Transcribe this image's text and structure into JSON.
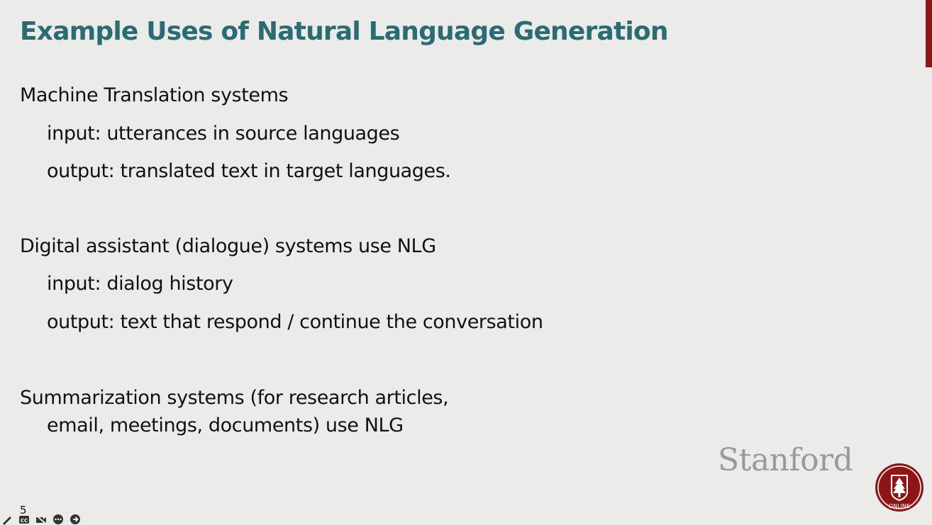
{
  "slide": {
    "title": "Example Uses of Natural Language Generation",
    "sections": [
      {
        "heading": "Machine Translation systems",
        "items": [
          "input: utterances in source languages",
          "output: translated text in target languages."
        ]
      },
      {
        "heading": "Digital assistant (dialogue) systems use NLG",
        "items": [
          "input: dialog history",
          "output: text that respond / continue the conversation"
        ]
      },
      {
        "heading": "Summarization systems (for research articles,",
        "items": [
          "email, meetings, documents) use NLG"
        ]
      }
    ],
    "slide_number": "5"
  },
  "branding": {
    "wordmark": "Stanford",
    "seal_text": "ONLINE",
    "seal_color": "#8c1515"
  },
  "toolbar": {
    "icons": [
      "pen-icon",
      "captions-icon",
      "camera-off-icon",
      "more-icon",
      "next-icon"
    ]
  },
  "colors": {
    "title": "#2b6b73",
    "text": "#111111",
    "background": "#ebebea",
    "accent": "#8c1515"
  }
}
